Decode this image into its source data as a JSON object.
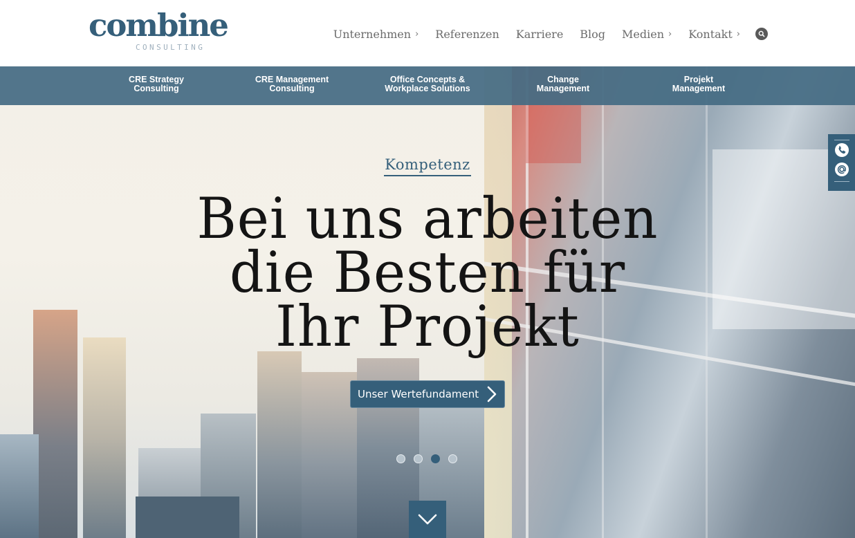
{
  "brand": {
    "name": "combine",
    "tagline": "CONSULTING"
  },
  "mainnav": {
    "items": [
      {
        "label": "Unternehmen",
        "has_submenu": true
      },
      {
        "label": "Referenzen",
        "has_submenu": false
      },
      {
        "label": "Karriere",
        "has_submenu": false
      },
      {
        "label": "Blog",
        "has_submenu": false
      },
      {
        "label": "Medien",
        "has_submenu": true
      },
      {
        "label": "Kontakt",
        "has_submenu": true
      }
    ],
    "chevron": "›",
    "search_icon": "search-icon"
  },
  "subnav": {
    "items": [
      {
        "line1": "CRE Strategy",
        "line2": "Consulting"
      },
      {
        "line1": "CRE Management",
        "line2": "Consulting"
      },
      {
        "line1": "Office Concepts &",
        "line2": "Workplace Solutions"
      },
      {
        "line1": "Change",
        "line2": "Management"
      },
      {
        "line1": "Projekt",
        "line2": "Management"
      }
    ]
  },
  "hero": {
    "eyebrow": "Kompetenz",
    "headline": [
      "Bei uns arbeiten",
      "die Besten für",
      "Ihr Projekt"
    ],
    "cta_label": "Unser Wertefundament",
    "slides_total": 4,
    "active_slide": 3
  },
  "contact_tab": {
    "icons": [
      "phone-icon",
      "email-at-icon"
    ]
  },
  "colors": {
    "brand_blue": "#355f7a",
    "subnav_bg": "#456c83",
    "nav_text": "#6b6b6b",
    "headline_text": "#141414",
    "logo_sub": "#9fb0bd"
  }
}
